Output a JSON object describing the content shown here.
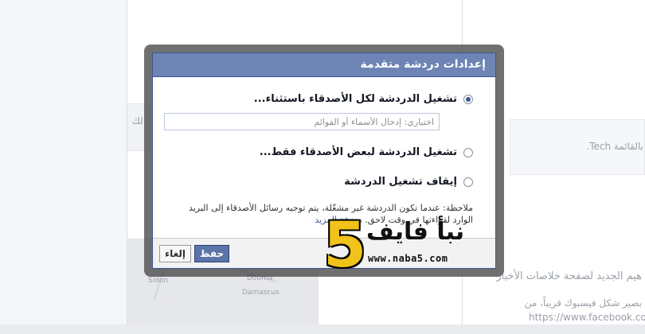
{
  "background": {
    "text_tech": "بالقائمة Tech.",
    "text_news": "هيم الجديد لصفحة خلاصات الأخبار",
    "text_facebook": "بصير شكل فيسبوك قريباً، من",
    "text_url": "https://www.facebook.co",
    "text_left": "لك",
    "map_sidon": "Sidon",
    "map_damascus": "Damascus",
    "map_douma": "Douma"
  },
  "dialog": {
    "title": "إعدادات دردشة متقدمة",
    "options": [
      {
        "label": "تشغيل الدردشة لكل الأصدقاء باستثناء...",
        "checked": true
      },
      {
        "label": "تشغيل الدردشة لبعض الأصدقاء فقط...",
        "checked": false
      },
      {
        "label": "إيقاف تشغيل الدردشة",
        "checked": false
      }
    ],
    "exceptions_placeholder": "اختياري: إدخال الأسماء أو القوائم",
    "note_text": "ملاحظة: عندما تكون الدردشة غير مشغّلة، يتم توجيه رسائل الأصدقاء إلى البريد الوارد لقراءتها في وقت لاحق.",
    "learn_more": "معرفة المزيد",
    "save_label": "حفظ",
    "cancel_label": "إلغاء"
  },
  "watermark": {
    "digit": "5",
    "word": "نبأ فايف",
    "url": "www.naba5.com"
  },
  "colors": {
    "header_bg": "#6d84b4",
    "border": "#3b5998",
    "save_bg": "#5b74a8",
    "logo_gold": "#f0c21a"
  }
}
